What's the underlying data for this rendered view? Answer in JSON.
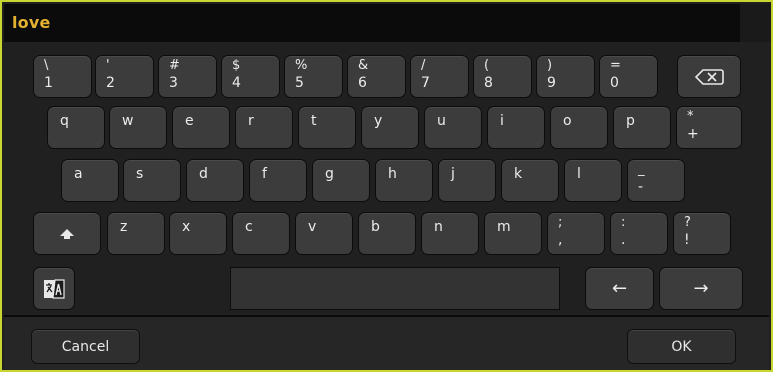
{
  "input": {
    "value": "love"
  },
  "rows": [
    [
      {
        "top": "\\",
        "bottom": "1"
      },
      {
        "top": "'",
        "bottom": "2"
      },
      {
        "top": "#",
        "bottom": "3"
      },
      {
        "top": "$",
        "bottom": "4"
      },
      {
        "top": "%",
        "bottom": "5"
      },
      {
        "top": "&",
        "bottom": "6"
      },
      {
        "top": "/",
        "bottom": "7"
      },
      {
        "top": "(",
        "bottom": "8"
      },
      {
        "top": ")",
        "bottom": "9"
      },
      {
        "top": "=",
        "bottom": "0"
      }
    ],
    [
      {
        "top": "q"
      },
      {
        "top": "w"
      },
      {
        "top": "e"
      },
      {
        "top": "r"
      },
      {
        "top": "t"
      },
      {
        "top": "y"
      },
      {
        "top": "u"
      },
      {
        "top": "i"
      },
      {
        "top": "o"
      },
      {
        "top": "p"
      },
      {
        "top": "*",
        "bottom": "+"
      }
    ],
    [
      {
        "top": "a"
      },
      {
        "top": "s"
      },
      {
        "top": "d"
      },
      {
        "top": "f"
      },
      {
        "top": "g"
      },
      {
        "top": "h"
      },
      {
        "top": "j"
      },
      {
        "top": "k"
      },
      {
        "top": "l"
      },
      {
        "top": "_",
        "bottom": "-"
      }
    ],
    [
      {
        "top": "z"
      },
      {
        "top": "x"
      },
      {
        "top": "c"
      },
      {
        "top": "v"
      },
      {
        "top": "b"
      },
      {
        "top": "n"
      },
      {
        "top": "m"
      },
      {
        "top": ";",
        "bottom": ","
      },
      {
        "top": ":",
        "bottom": "."
      },
      {
        "top": "?",
        "bottom": "!"
      }
    ]
  ],
  "icons": {
    "backspace": "backspace-icon",
    "shift": "shift-up-arrow-icon",
    "language": "language-switch-icon",
    "left_arrow": "←",
    "right_arrow": "→"
  },
  "buttons": {
    "cancel": "Cancel",
    "ok": "OK"
  },
  "colors": {
    "accent_text": "#e3b02f",
    "frame_border": "#c8d630",
    "key_fill": "#3c3c3c"
  }
}
